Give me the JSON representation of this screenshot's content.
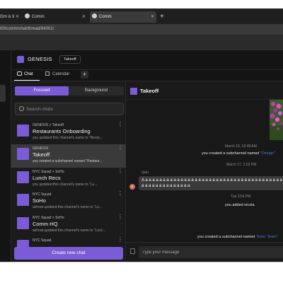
{
  "browser": {
    "tabs": [
      {
        "title": "Gm is ti"
      },
      {
        "title": "Comm"
      },
      {
        "title": "Comm"
      }
    ],
    "new_tab_label": "+",
    "url": "00/comm/chat/thread/84001/"
  },
  "workspace": {
    "name": "GENESIS",
    "channel_chip": "Takeoff"
  },
  "nav": {
    "tabs": [
      {
        "label": "Chat",
        "icon": "chat-bubble-icon"
      },
      {
        "label": "Calendar",
        "icon": "calendar-icon"
      }
    ],
    "add_label": "+"
  },
  "sidebar": {
    "segments": {
      "focused": "Focused",
      "background": "Background"
    },
    "search_placeholder": "Search chats",
    "chats": [
      {
        "crumb": "GENESIS > Takeoff",
        "name": "Restaurants Onboarding",
        "preview": "you updated this channel's name to \"Resta...",
        "active": false
      },
      {
        "crumb": "GENESIS",
        "name": "Takeoff",
        "preview": "you created a subchannel named \"Restaur...",
        "active": true
      },
      {
        "crumb": "NYC Squad > SoHo",
        "name": "Lunch Recs",
        "preview": "you updated this channel's name to \"Lu...",
        "active": false
      },
      {
        "crumb": "NYC Squad",
        "name": "SoHo",
        "preview": "ashoat updated this channel's name to \"Lo...",
        "active": false
      },
      {
        "crumb": "NYC Squad > SoHo",
        "name": "Comm HQ",
        "preview": "ashoat updated this channel's name to \"Lunc...",
        "active": false
      },
      {
        "crumb": "NYC Squad",
        "name": "",
        "preview": "",
        "active": false
      }
    ],
    "new_chat_label": "Create new chat"
  },
  "conversation": {
    "title": "Takeoff",
    "timestamp_1": "March 16, 12:48 AM",
    "event_1": {
      "prefix": "you created a subchannel named ",
      "link": "\"Design\""
    },
    "timestamp_2": "March 17, 2:03 PM",
    "message": {
      "sender": "ryan",
      "avatar_initial": "R",
      "text": "A a a a a a a a a a a a a a a a a a a a a a a a a a a a a a a a a a a a a a a a a a a a a a a a a a a a a a"
    },
    "timestamp_3": "Tue 3:54 PM",
    "event_2": "you added nicola",
    "event_3": {
      "prefix": "you created a subchannel named ",
      "link": "\"Exec Team\""
    },
    "composer_placeholder": "Type your message"
  },
  "colors": {
    "accent": "#7b5cd6",
    "link": "#4b7bdc",
    "app_bg": "#141414",
    "sidebar_bg": "#1b1b1b"
  }
}
